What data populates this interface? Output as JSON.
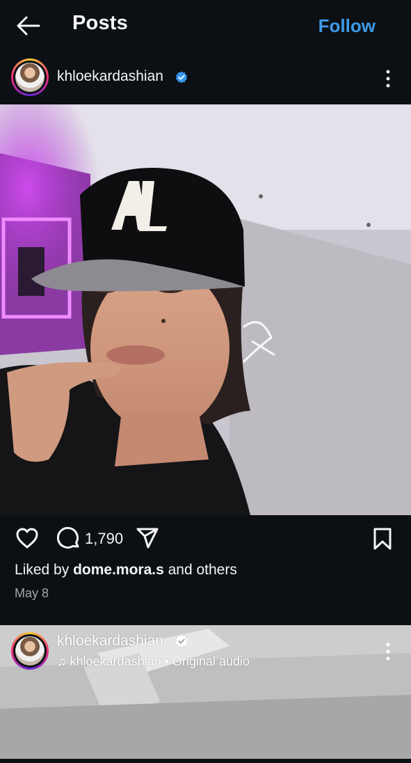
{
  "header": {
    "title": "Posts",
    "follow_label": "Follow",
    "back_icon": "arrow-left-icon"
  },
  "post": {
    "username": "khloekardashian",
    "verified": true,
    "comment_count": "1,790",
    "liked_by_prefix": "Liked by ",
    "liked_by_user": "dome.mora.s",
    "liked_by_suffix": " and others",
    "date": "May 8",
    "icons": [
      "heart-icon",
      "comment-icon",
      "share-icon",
      "bookmark-icon",
      "more-icon"
    ]
  },
  "next_post": {
    "username": "khloekardashian",
    "verified": true,
    "audio_user": "khloekardashian",
    "audio_sep": " • ",
    "audio_label": "Original audio"
  },
  "colors": {
    "background": "#0c1014",
    "accent": "#3d9be9",
    "verified": "#3897f0",
    "muted": "#a8a8a8"
  }
}
